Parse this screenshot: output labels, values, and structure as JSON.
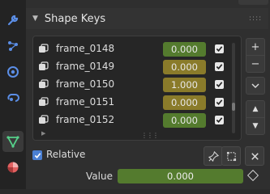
{
  "colors": {
    "value_green": "#547b2e",
    "value_olive": "#8a7b2a",
    "checkbox_blue": "#4a7fd2"
  },
  "tabs": [
    {
      "icon": "wrench-icon",
      "color": "#5b8ee6"
    },
    {
      "icon": "particles-icon",
      "color": "#5b8ee6"
    },
    {
      "icon": "physics-icon",
      "color": "#5b8ee6"
    },
    {
      "icon": "constraint-icon",
      "color": "#5b8ee6"
    },
    {
      "icon": "mesh-data-icon",
      "color": "#56d08a"
    },
    {
      "icon": "material-icon",
      "color": "#e26060"
    }
  ],
  "panel": {
    "title": "Shape Keys"
  },
  "shape_keys": [
    {
      "name": "frame_0148",
      "value": "0.000",
      "color": "#547b2e",
      "enabled": true
    },
    {
      "name": "frame_0149",
      "value": "0.000",
      "color": "#8a7b2a",
      "enabled": true
    },
    {
      "name": "frame_0150",
      "value": "1.000",
      "color": "#8a7b2a",
      "enabled": true
    },
    {
      "name": "frame_0151",
      "value": "0.000",
      "color": "#8a7b2a",
      "enabled": true
    },
    {
      "name": "frame_0152",
      "value": "0.000",
      "color": "#547b2e",
      "enabled": true
    }
  ],
  "side_buttons": {
    "add": "+",
    "remove": "−"
  },
  "relative": {
    "label": "Relative",
    "checked": true
  },
  "value": {
    "label": "Value",
    "value": "0.000"
  }
}
